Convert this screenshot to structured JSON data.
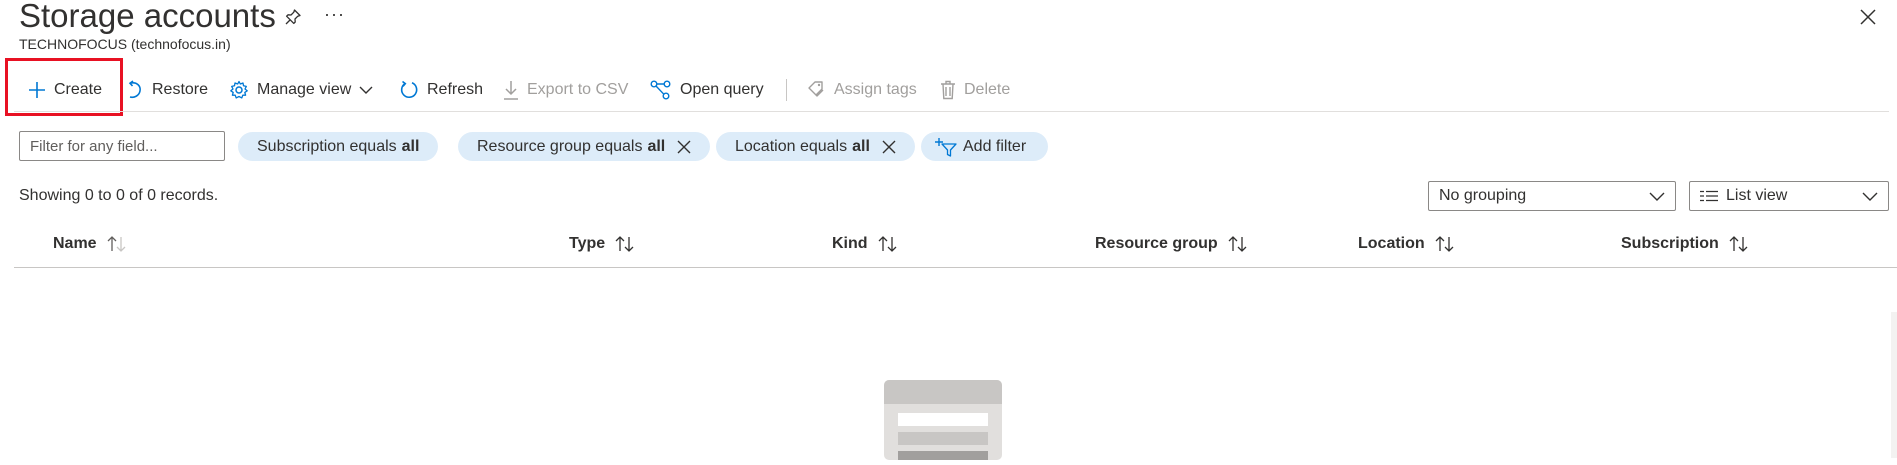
{
  "header": {
    "title": "Storage accounts",
    "subtitle": "TECHNOFOCUS (technofocus.in)",
    "more_glyph": "···"
  },
  "toolbar": {
    "create_label": "Create",
    "restore_label": "Restore",
    "manage_view_label": "Manage view",
    "refresh_label": "Refresh",
    "export_label": "Export to CSV",
    "open_query_label": "Open query",
    "assign_tags_label": "Assign tags",
    "delete_label": "Delete"
  },
  "filters": {
    "placeholder": "Filter for any field...",
    "pills": [
      {
        "label": "Subscription equals",
        "value": "all",
        "removable": false
      },
      {
        "label": "Resource group equals",
        "value": "all",
        "removable": true
      },
      {
        "label": "Location equals",
        "value": "all",
        "removable": true
      }
    ],
    "add_filter_label": "Add filter"
  },
  "records_text": "Showing 0 to 0 of 0 records.",
  "grouping": {
    "selected": "No grouping"
  },
  "view_mode": {
    "selected": "List view"
  },
  "table": {
    "columns": [
      "Name",
      "Type",
      "Kind",
      "Resource group",
      "Location",
      "Subscription"
    ],
    "rows": []
  },
  "colors": {
    "accent": "#0078d4",
    "highlight_border": "#e81123",
    "pill_bg": "#ddecf9",
    "disabled_text": "#a19f9d"
  },
  "icons": {
    "create": "plus-icon",
    "restore": "undo-icon",
    "manage_view": "gear-icon",
    "refresh": "refresh-icon",
    "export": "download-icon",
    "open_query": "share-graph-icon",
    "assign_tags": "tag-icon",
    "delete": "trash-icon",
    "add_filter": "filter-add-icon"
  }
}
